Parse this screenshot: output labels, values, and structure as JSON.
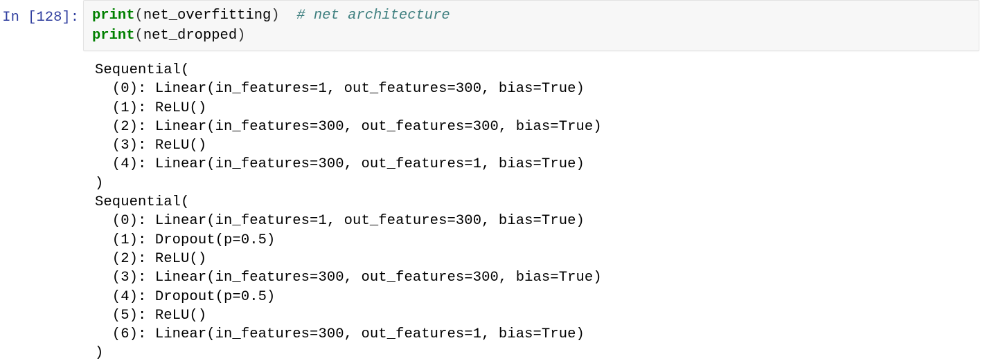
{
  "cell": {
    "prompt_label": "In [128]:",
    "execution_count": 128,
    "prompt_color": "#303f9f",
    "cell_background": "#f7f7f7",
    "cell_border": "#e3e3e3",
    "code_lines": [
      {
        "builtin": "print",
        "open_paren": "(",
        "arg": "net_overfitting",
        "close_paren": ")",
        "spacer": "  ",
        "comment": "# net architecture"
      },
      {
        "builtin": "print",
        "open_paren": "(",
        "arg": "net_dropped",
        "close_paren": ")",
        "spacer": "",
        "comment": ""
      }
    ],
    "syntax_colors": {
      "builtin": "#008000",
      "comment": "#408080",
      "text": "#000000"
    }
  },
  "output": {
    "text": "Sequential(\n  (0): Linear(in_features=1, out_features=300, bias=True)\n  (1): ReLU()\n  (2): Linear(in_features=300, out_features=300, bias=True)\n  (3): ReLU()\n  (4): Linear(in_features=300, out_features=1, bias=True)\n)\nSequential(\n  (0): Linear(in_features=1, out_features=300, bias=True)\n  (1): Dropout(p=0.5)\n  (2): ReLU()\n  (3): Linear(in_features=300, out_features=300, bias=True)\n  (4): Dropout(p=0.5)\n  (5): ReLU()\n  (6): Linear(in_features=300, out_features=1, bias=True)\n)",
    "lines": [
      "Sequential(",
      "  (0): Linear(in_features=1, out_features=300, bias=True)",
      "  (1): ReLU()",
      "  (2): Linear(in_features=300, out_features=300, bias=True)",
      "  (3): ReLU()",
      "  (4): Linear(in_features=300, out_features=1, bias=True)",
      ")",
      "Sequential(",
      "  (0): Linear(in_features=1, out_features=300, bias=True)",
      "  (1): Dropout(p=0.5)",
      "  (2): ReLU()",
      "  (3): Linear(in_features=300, out_features=300, bias=True)",
      "  (4): Dropout(p=0.5)",
      "  (5): ReLU()",
      "  (6): Linear(in_features=300, out_features=1, bias=True)",
      ")"
    ]
  }
}
